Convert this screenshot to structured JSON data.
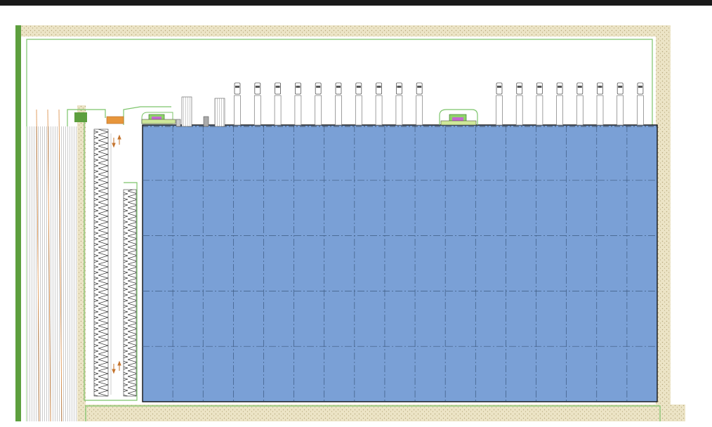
{
  "drawing": {
    "colors": {
      "background": "#ffffff",
      "top_bar": "#1a1a1a",
      "gravel_fill": "#ece4c6",
      "gravel_dot": "#b5a77a",
      "site_outline": "#7cc46a",
      "green_strip": "#5d9f3e",
      "warehouse_fill": "#7aa0d6",
      "warehouse_grid": "#3d5a80",
      "warehouse_outline": "#111111",
      "parking_stripes": "#9a9a9a",
      "parking_lines_orange": "#d9893f",
      "road_arrow": "#c4742e",
      "truck_stroke": "#555555",
      "guardhouse_fill": "#8fd46a",
      "guardhouse_detail": "#c46ad0"
    },
    "warehouse": {
      "columns": 17,
      "rows": 5
    },
    "truck_docks": {
      "left_group": 10,
      "right_group": 8
    },
    "stair_stack_labels": []
  }
}
